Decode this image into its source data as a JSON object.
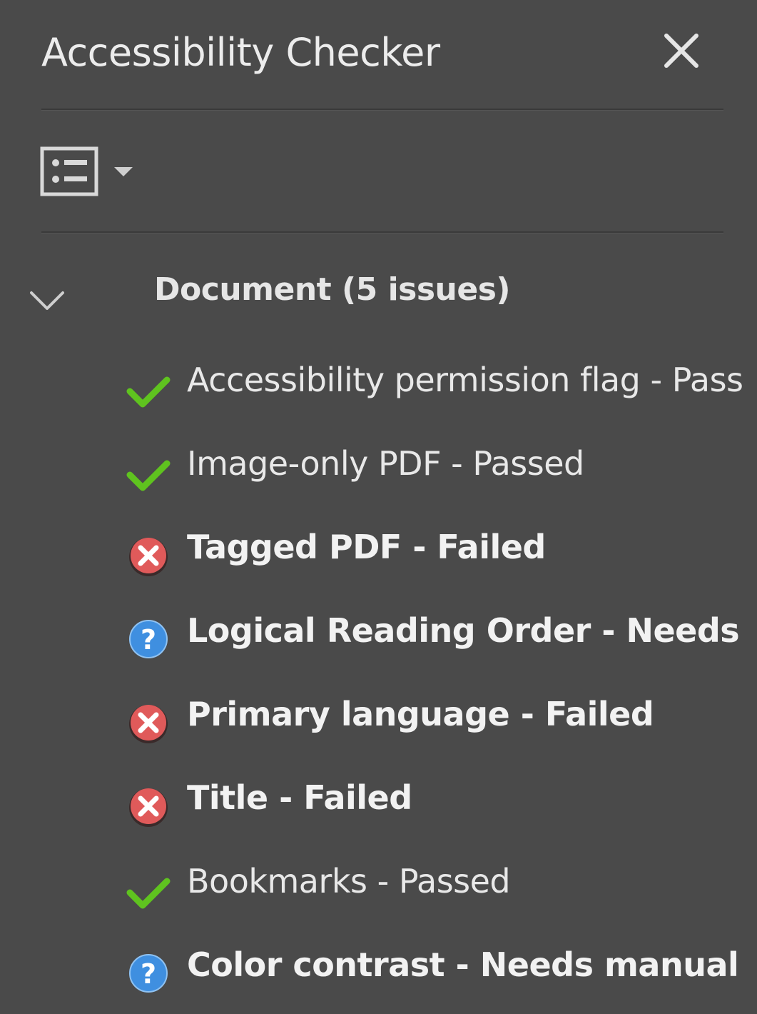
{
  "panel": {
    "title": "Accessibility Checker",
    "close_icon": "close-icon",
    "view_icon": "list-view-icon",
    "dropdown_icon": "caret-down-icon"
  },
  "group": {
    "label": "Document (5 issues)",
    "expanded": true,
    "chevron_icon": "chevron-down-icon"
  },
  "items": [
    {
      "label": "Accessibility permission flag - Passed",
      "status": "passed",
      "bold": false
    },
    {
      "label": "Image-only PDF - Passed",
      "status": "passed",
      "bold": false
    },
    {
      "label": "Tagged PDF - Failed",
      "status": "failed",
      "bold": true
    },
    {
      "label": "Logical Reading Order - Needs manual check",
      "status": "manual",
      "bold": true
    },
    {
      "label": "Primary language - Failed",
      "status": "failed",
      "bold": true
    },
    {
      "label": "Title - Failed",
      "status": "failed",
      "bold": true
    },
    {
      "label": "Bookmarks - Passed",
      "status": "passed",
      "bold": false
    },
    {
      "label": "Color contrast - Needs manual check",
      "status": "manual",
      "bold": true
    }
  ],
  "colors": {
    "background": "#4a4a4a",
    "passed": "#5fc31f",
    "failed": "#e05a5a",
    "manual": "#3f8fe0"
  }
}
